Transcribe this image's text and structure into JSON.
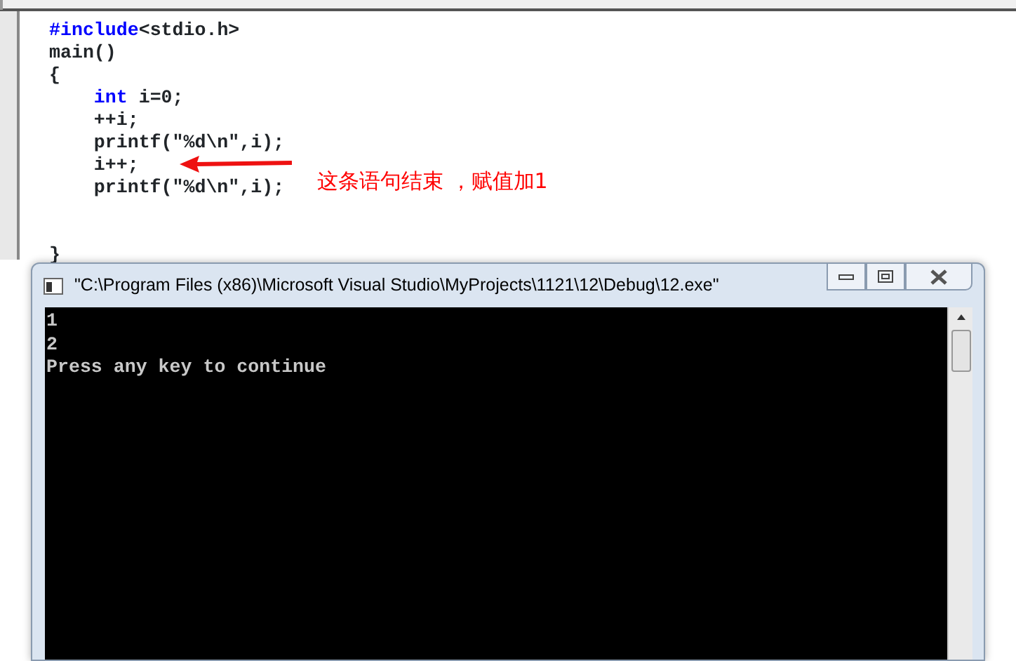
{
  "editor": {
    "lines": [
      {
        "kind": "code",
        "indented": false,
        "tokens": [
          {
            "text": "#include",
            "kind": "keyword"
          },
          {
            "text": "<stdio.h>",
            "kind": "plain"
          }
        ]
      },
      {
        "kind": "code",
        "indented": false,
        "tokens": [
          {
            "text": "main()",
            "kind": "plain"
          }
        ]
      },
      {
        "kind": "code",
        "indented": false,
        "tokens": [
          {
            "text": "{",
            "kind": "plain"
          }
        ]
      },
      {
        "kind": "code",
        "indented": true,
        "tokens": [
          {
            "text": "int",
            "kind": "keyword"
          },
          {
            "text": " i=0;",
            "kind": "plain"
          }
        ]
      },
      {
        "kind": "code",
        "indented": true,
        "tokens": [
          {
            "text": "++i;",
            "kind": "plain"
          }
        ]
      },
      {
        "kind": "code",
        "indented": true,
        "tokens": [
          {
            "text": "printf(\"%d\\n\",i);",
            "kind": "plain"
          }
        ]
      },
      {
        "kind": "code",
        "indented": true,
        "tokens": [
          {
            "text": "i++;",
            "kind": "plain"
          }
        ],
        "annotation": "这条语句结束 ，赋值加1"
      },
      {
        "kind": "code",
        "indented": true,
        "tokens": [
          {
            "text": "printf(\"%d\\n\",i);",
            "kind": "plain"
          }
        ]
      },
      {
        "kind": "blank"
      },
      {
        "kind": "blank"
      },
      {
        "kind": "code",
        "indented": false,
        "tokens": [
          {
            "text": "}",
            "kind": "plain"
          }
        ]
      }
    ]
  },
  "console": {
    "title": "\"C:\\Program Files (x86)\\Microsoft Visual Studio\\MyProjects\\1121\\12\\Debug\\12.exe\"",
    "output": [
      "1",
      "2",
      "Press any key to continue"
    ]
  }
}
